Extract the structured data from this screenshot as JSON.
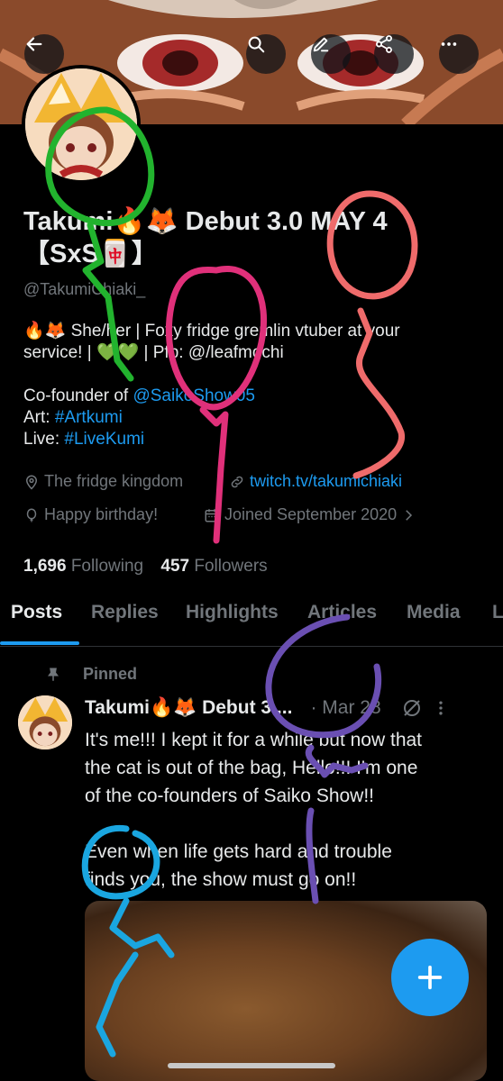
{
  "profile": {
    "name_line1": "Takumi🔥🦊 Debut 3.0 MAY 4",
    "name_line2": "【SxS🀄】",
    "handle": "@TakumiChiaki_",
    "bio": {
      "line1": "🔥🦊 She/her | Foxy fridge gremlin vtuber at your",
      "line2": "service! | 💚💚 | Pfp: @/leafmochi",
      "cofounder_prefix": "Co-founder of ",
      "cofounder_link": "@SaikoShow05",
      "art_prefix": "Art: ",
      "art_tag": "#Artkumi",
      "live_prefix": "Live: ",
      "live_tag": "#LiveKumi"
    },
    "location": "The fridge kingdom",
    "website": "twitch.tv/takumichiaki",
    "birthday": "Happy birthday!",
    "joined": "Joined September 2020",
    "following_count": "1,696",
    "following_label": " Following",
    "followers_count": "457",
    "followers_label": " Followers"
  },
  "tabs": [
    "Posts",
    "Replies",
    "Highlights",
    "Articles",
    "Media",
    "L"
  ],
  "post": {
    "pinned_label": "Pinned",
    "author": "Takumi🔥🦊 Debut 3....",
    "date": "· Mar 28",
    "line1": "It's me!!! I kept it for a while but now that",
    "line2": "the cat is out of the bag, Hello!!! I'm one",
    "line3": "of the co-founders of Saiko Show!!",
    "line4": "Even when life gets hard and trouble",
    "line5": "finds you, the show must go on!!"
  },
  "icons": {
    "back": "back-arrow-icon",
    "search": "search-icon",
    "edit": "edit-icon",
    "share": "share-icon",
    "more": "more-icon",
    "location": "location-pin-icon",
    "link": "link-icon",
    "birthday": "balloon-icon",
    "calendar": "calendar-icon",
    "pin": "pin-icon",
    "grok": "slash-circle-icon",
    "compose": "plus-icon"
  },
  "colors": {
    "accent": "#1d9bf0",
    "background": "#000000",
    "muted": "#71767b"
  }
}
